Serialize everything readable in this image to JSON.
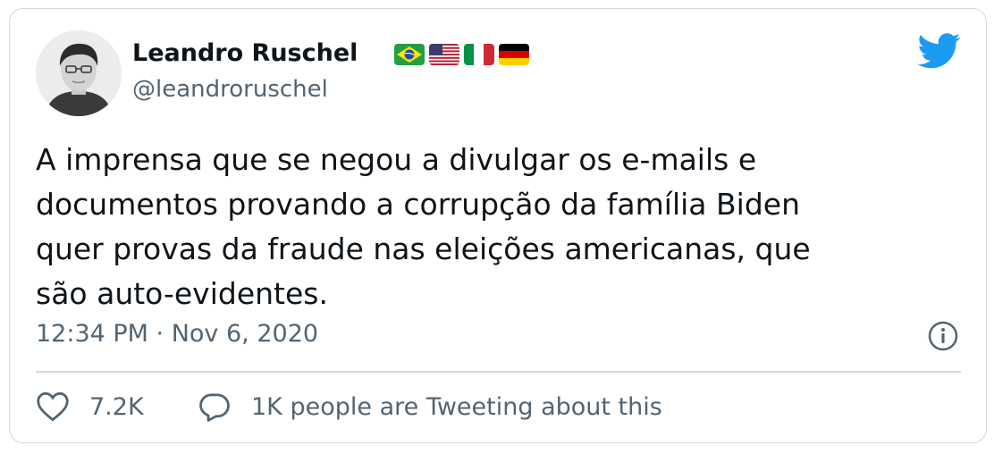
{
  "author": {
    "name": "Leandro Ruschel",
    "handle": "@leandroruschel",
    "flags": [
      "brazil-flag",
      "usa-flag",
      "italy-flag",
      "germany-flag"
    ]
  },
  "tweet": {
    "text": "A imprensa que se negou a divulgar os e-mails e\ndocumentos provando a corrupção da família Biden\nquer provas da fraude nas eleições americanas, que\nsão auto-evidentes.",
    "timestamp": "12:34 PM · Nov 6, 2020"
  },
  "actions": {
    "likes": "7.2K",
    "tweeting": "1K people are Tweeting about this"
  },
  "colors": {
    "twitter_blue": "#1d9bf0",
    "text_primary": "#0f1419",
    "text_secondary": "#536471",
    "border": "#cfd9de"
  }
}
